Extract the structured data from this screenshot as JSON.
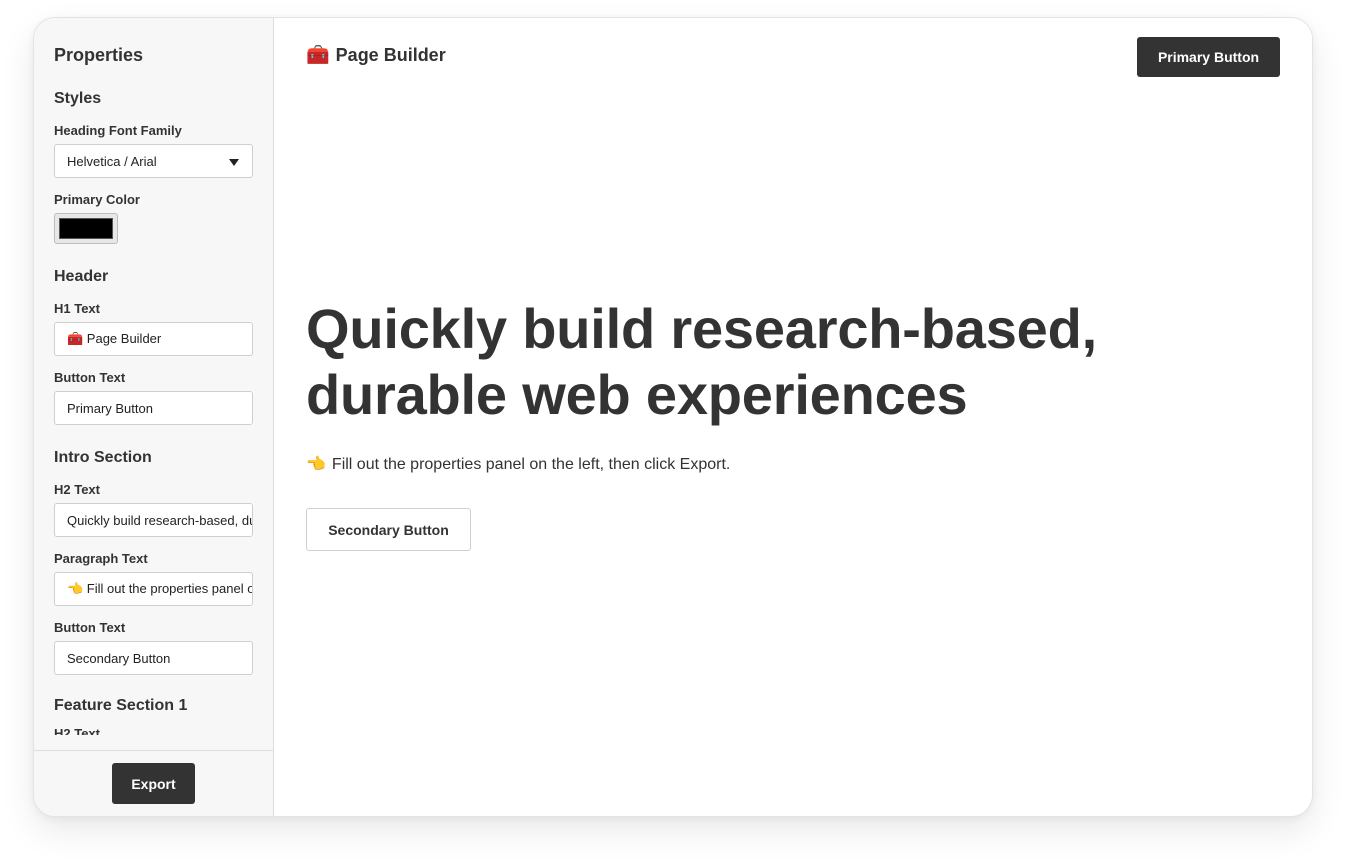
{
  "sidebar": {
    "title": "Properties",
    "styles": {
      "section_title": "Styles",
      "heading_font_label": "Heading Font Family",
      "heading_font_value": "Helvetica / Arial",
      "primary_color_label": "Primary Color",
      "primary_color_value": "#000000"
    },
    "header": {
      "section_title": "Header",
      "h1_label": "H1 Text",
      "h1_value": "🧰 Page Builder",
      "button_label": "Button Text",
      "button_value": "Primary Button"
    },
    "intro": {
      "section_title": "Intro Section",
      "h2_label": "H2 Text",
      "h2_value": "Quickly build research-based, durable web experiences",
      "paragraph_label": "Paragraph Text",
      "paragraph_value": "👈 Fill out the properties panel on the left, then click Export.",
      "button_label": "Button Text",
      "button_value": "Secondary Button"
    },
    "feature1": {
      "section_title": "Feature Section 1",
      "h2_label": "H2 Text"
    },
    "export_label": "Export"
  },
  "preview": {
    "brand_icon": "🧰",
    "brand_text": "Page Builder",
    "primary_button": "Primary Button",
    "hero_title": "Quickly build research-based, durable web experiences",
    "paragraph_icon": "👈",
    "paragraph_text": "Fill out the properties panel on the left, then click Export.",
    "secondary_button": "Secondary Button"
  },
  "colors": {
    "dark": "#333333",
    "sidebar_bg": "#f7f7f7",
    "border": "#dedede"
  }
}
